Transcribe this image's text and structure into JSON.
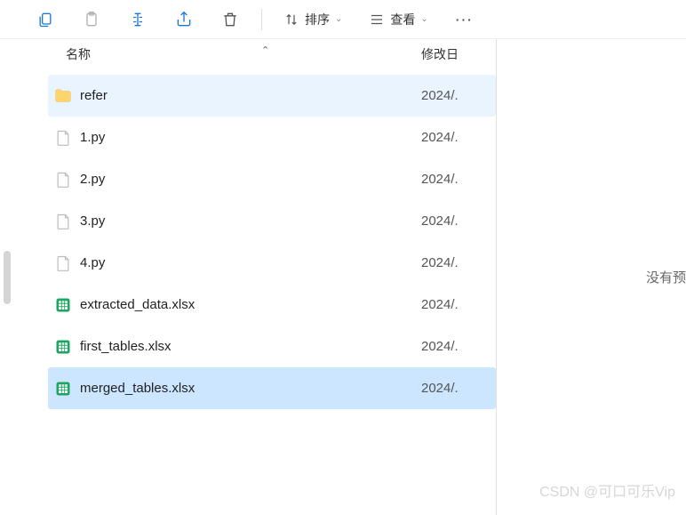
{
  "toolbar": {
    "sort_label": "排序",
    "view_label": "查看"
  },
  "columns": {
    "name": "名称",
    "modified": "修改日"
  },
  "files": [
    {
      "name": "refer",
      "date": "2024/.",
      "type": "folder",
      "state": "hover"
    },
    {
      "name": "1.py",
      "date": "2024/.",
      "type": "file",
      "state": ""
    },
    {
      "name": "2.py",
      "date": "2024/.",
      "type": "file",
      "state": ""
    },
    {
      "name": "3.py",
      "date": "2024/.",
      "type": "file",
      "state": ""
    },
    {
      "name": "4.py",
      "date": "2024/.",
      "type": "file",
      "state": ""
    },
    {
      "name": "extracted_data.xlsx",
      "date": "2024/.",
      "type": "xlsx",
      "state": ""
    },
    {
      "name": "first_tables.xlsx",
      "date": "2024/.",
      "type": "xlsx",
      "state": ""
    },
    {
      "name": "merged_tables.xlsx",
      "date": "2024/.",
      "type": "xlsx",
      "state": "selected"
    }
  ],
  "preview": {
    "empty_text": "没有预"
  },
  "watermark": "CSDN @可口可乐Vip"
}
